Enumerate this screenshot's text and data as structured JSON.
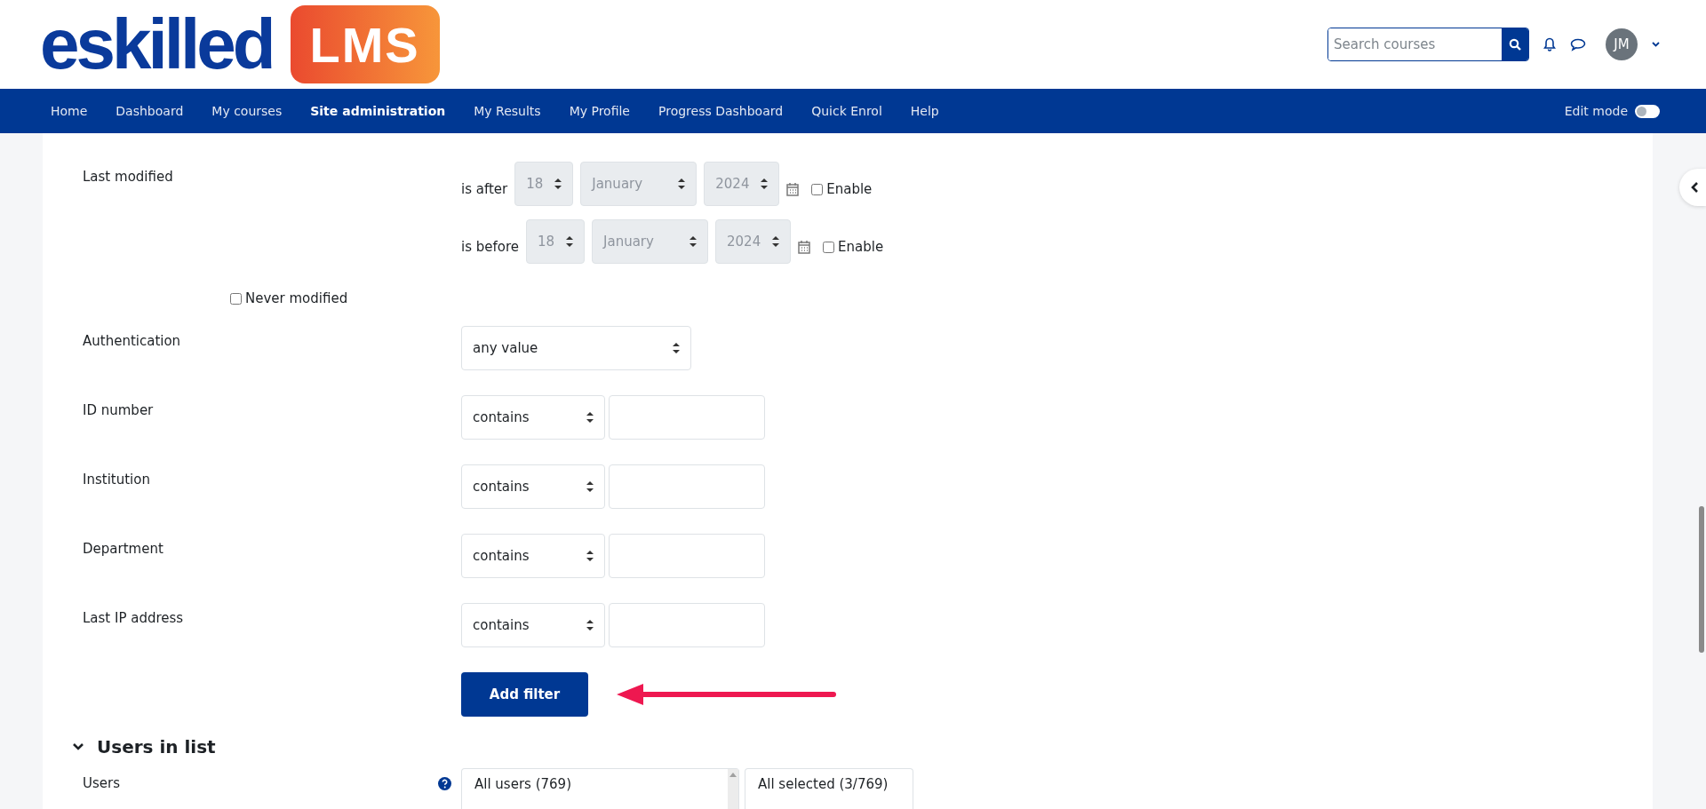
{
  "header": {
    "logo": {
      "wordmark": "eskilled",
      "badge": "LMS"
    },
    "search": {
      "placeholder": "Search courses"
    },
    "avatar": {
      "initials": "JM"
    }
  },
  "nav": {
    "items": [
      {
        "label": "Home",
        "selected": false
      },
      {
        "label": "Dashboard",
        "selected": false
      },
      {
        "label": "My courses",
        "selected": false
      },
      {
        "label": "Site administration",
        "selected": true
      },
      {
        "label": "My Results",
        "selected": false
      },
      {
        "label": "My Profile",
        "selected": false
      },
      {
        "label": "Progress Dashboard",
        "selected": false
      },
      {
        "label": "Quick Enrol",
        "selected": false
      },
      {
        "label": "Help",
        "selected": false
      }
    ],
    "edit_mode": {
      "label": "Edit mode",
      "on": false
    }
  },
  "filters": [
    {
      "kind": "date",
      "label": "Last modified",
      "conditions": [
        {
          "operator": "is after",
          "day": "18",
          "month": "January",
          "year": "2024",
          "enable_label": "Enable",
          "enabled": false
        },
        {
          "operator": "is before",
          "day": "18",
          "month": "January",
          "year": "2024",
          "enable_label": "Enable",
          "enabled": false
        }
      ],
      "never": {
        "label": "Never modified",
        "checked": false
      }
    },
    {
      "kind": "select",
      "label": "Authentication",
      "value": "any value"
    },
    {
      "kind": "text",
      "label": "ID number",
      "operator": "contains"
    },
    {
      "kind": "text",
      "label": "Institution",
      "operator": "contains"
    },
    {
      "kind": "text",
      "label": "Department",
      "operator": "contains"
    },
    {
      "kind": "text",
      "label": "Last IP address",
      "operator": "contains"
    }
  ],
  "add_filter": "Add filter",
  "users_in_list": {
    "title": "Users in list",
    "expanded": true,
    "label": "Users",
    "available": "All users (769)",
    "selected": "All selected (3/769)"
  }
}
